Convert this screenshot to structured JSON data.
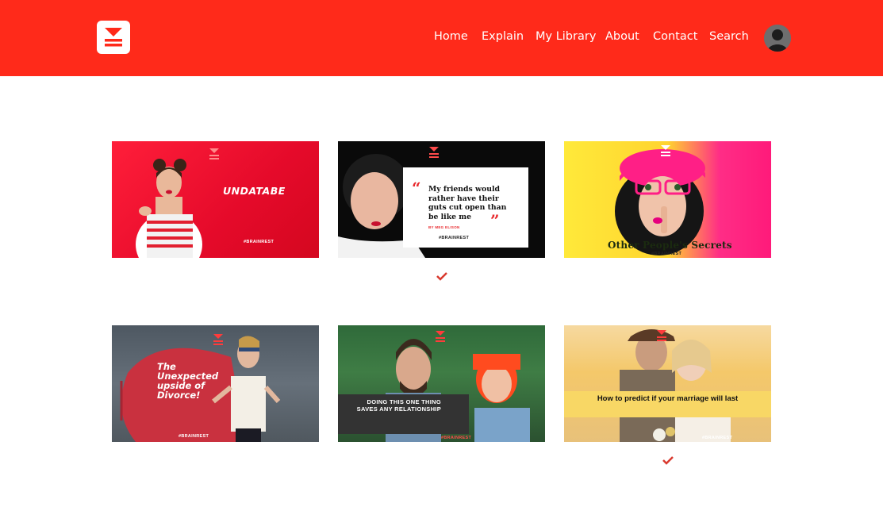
{
  "header": {
    "background_color": "#ff2a1a",
    "logo_icon": "brainrest-logo",
    "nav": [
      "Home",
      "Explain",
      "My Library",
      "About",
      "Contact",
      "Search"
    ],
    "avatar_icon": "user-avatar"
  },
  "cards": [
    {
      "title": "UNDATABE",
      "brand": "#BRAINREST",
      "checked": false
    },
    {
      "quote": "My friends would rather have their guts cut open than be like me",
      "author": "BY MEG ELISON",
      "brand": "#BRAINREST",
      "checked": true
    },
    {
      "title": "Other People's Secrets",
      "brand": "#BRAINREST",
      "checked": false
    },
    {
      "title": "The Unexpected upside of Divorce!",
      "brand": "#BRAINREST",
      "checked": false
    },
    {
      "title": "DOING THIS ONE THING SAVES ANY RELATIONSHIP",
      "brand": "#BRAINREST",
      "checked": false
    },
    {
      "title": "How to predict if your marriage will last",
      "brand": "#BRAINREST",
      "checked": true
    }
  ],
  "colors": {
    "accent": "#e8292d",
    "check": "#d93a2f"
  }
}
